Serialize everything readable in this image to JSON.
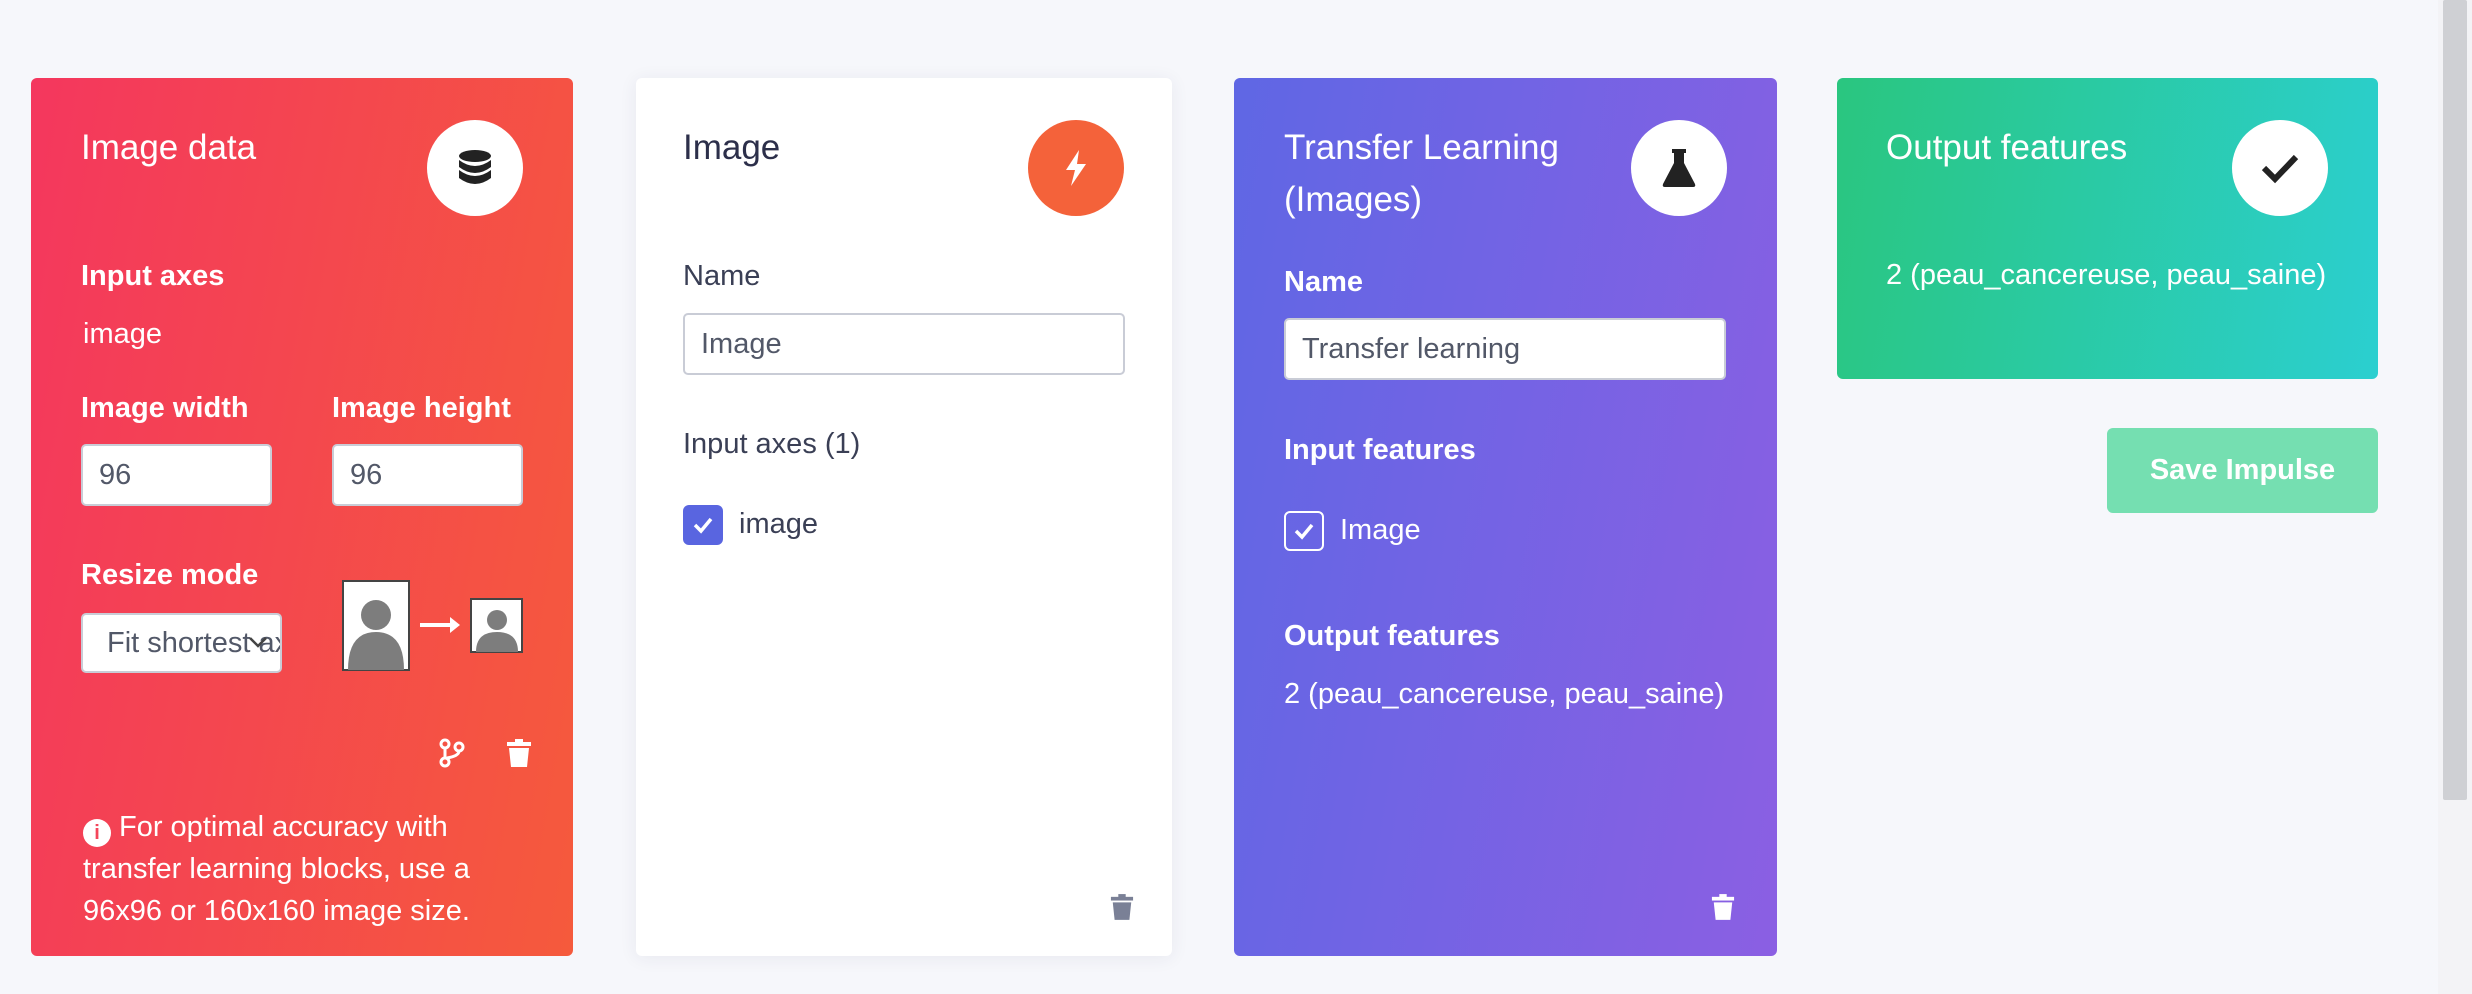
{
  "image_data_block": {
    "title": "Image data",
    "input_axes_label": "Input axes",
    "input_axes_value": "image",
    "width_label": "Image width",
    "width_value": "96",
    "height_label": "Image height",
    "height_value": "96",
    "resize_label": "Resize mode",
    "resize_value": "Fit shortest axis",
    "info_text": "For optimal accuracy with transfer learning blocks, use a 96x96 or 160x160 image size.",
    "icon": "database-icon",
    "color_start": "#f4375e",
    "color_end": "#f55a3c"
  },
  "processing_block": {
    "title": "Image",
    "name_label": "Name",
    "name_value": "Image",
    "input_axes_label": "Input axes (1)",
    "axis_option": "image",
    "axis_checked": true,
    "icon": "bolt-icon",
    "icon_color": "#f4623a"
  },
  "learning_block": {
    "title_line1": "Transfer Learning",
    "title_line2": "(Images)",
    "name_label": "Name",
    "name_value": "Transfer learning",
    "input_features_label": "Input features",
    "feature_option": "Image",
    "feature_checked": true,
    "output_features_label": "Output features",
    "output_features_value": "2 (peau_cancereuse, peau_saine)",
    "icon": "flask-icon",
    "color_start": "#5f67e4",
    "color_end": "#8b5fe3"
  },
  "output_block": {
    "title": "Output features",
    "value": "2 (peau_cancereuse, peau_saine)",
    "icon": "check-icon",
    "color_start": "#2ac67f",
    "color_end": "#2bcfd0"
  },
  "save_button_label": "Save Impulse"
}
